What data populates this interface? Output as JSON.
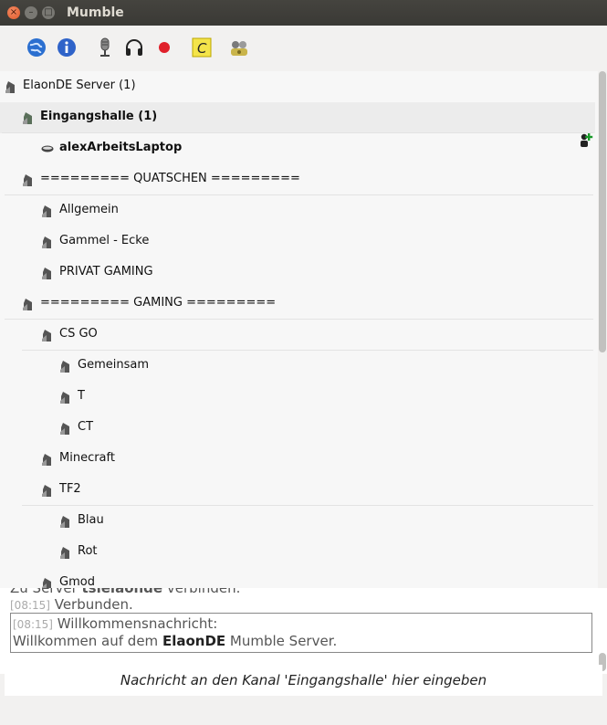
{
  "window": {
    "title": "Mumble"
  },
  "toolbar": {
    "items": [
      {
        "name": "server-connect-icon",
        "icon": "globe-icon",
        "color": "#2b6fd0"
      },
      {
        "name": "info-icon",
        "icon": "info-icon",
        "color": "#2f63c9"
      },
      {
        "name": "microphone-icon",
        "icon": "microphone-icon",
        "color": "#555555"
      },
      {
        "name": "headphones-icon",
        "icon": "headphones-icon",
        "color": "#222222"
      },
      {
        "name": "record-icon",
        "icon": "record-icon",
        "color": "#e0202a"
      },
      {
        "name": "comment-icon",
        "icon": "comment-icon",
        "color": "#e8d62a"
      },
      {
        "name": "configure-icon",
        "icon": "gear-users-icon",
        "color": "#7a7a7a"
      }
    ]
  },
  "tree": {
    "rows": [
      {
        "label": "ElaonDE Server (1)",
        "indent": 0,
        "kind": "server"
      },
      {
        "label": "Eingangshalle (1)",
        "indent": 1,
        "kind": "channel-active",
        "bold": true
      },
      {
        "label": "alexArbeitsLaptop",
        "indent": 2,
        "kind": "user",
        "bold": true
      },
      {
        "label": "========= QUATSCHEN =========",
        "indent": 1,
        "kind": "channel"
      },
      {
        "label": "Allgemein",
        "indent": 2,
        "kind": "channel"
      },
      {
        "label": "Gammel - Ecke",
        "indent": 2,
        "kind": "channel"
      },
      {
        "label": "PRIVAT GAMING",
        "indent": 2,
        "kind": "channel"
      },
      {
        "label": "========= GAMING =========",
        "indent": 1,
        "kind": "channel"
      },
      {
        "label": "CS GO",
        "indent": 2,
        "kind": "channel"
      },
      {
        "label": "Gemeinsam",
        "indent": 3,
        "kind": "channel"
      },
      {
        "label": "T",
        "indent": 3,
        "kind": "channel"
      },
      {
        "label": "CT",
        "indent": 3,
        "kind": "channel"
      },
      {
        "label": "Minecraft",
        "indent": 2,
        "kind": "channel"
      },
      {
        "label": "TF2",
        "indent": 2,
        "kind": "channel"
      },
      {
        "label": "Blau",
        "indent": 3,
        "kind": "channel"
      },
      {
        "label": "Rot",
        "indent": 3,
        "kind": "channel"
      },
      {
        "label": "Gmod",
        "indent": 2,
        "kind": "channel"
      }
    ]
  },
  "log": {
    "partial_line": {
      "text_prefix": "Zu Server ",
      "bold": "tsielaonde",
      "text_suffix": " verbinden."
    },
    "connected": {
      "time": "[08:15]",
      "text": "Verbunden."
    },
    "welcome": {
      "time": "[08:15]",
      "title": "Willkommensnachricht:",
      "prefix": "Willkommen auf dem ",
      "bold": "ElaonDE",
      "suffix": " Mumble Server."
    }
  },
  "input": {
    "placeholder": "Nachricht an den Kanal 'Eingangshalle' hier eingeben"
  }
}
